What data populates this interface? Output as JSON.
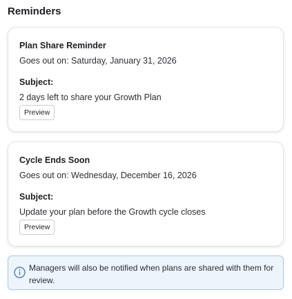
{
  "page": {
    "title": "Reminders"
  },
  "reminders": [
    {
      "title": "Plan Share Reminder",
      "goes_out": "Goes out on: Saturday, January 31, 2026",
      "subject_label": "Subject:",
      "subject": "2 days left to share your Growth Plan",
      "preview_label": "Preview"
    },
    {
      "title": "Cycle Ends Soon",
      "goes_out": "Goes out on: Wednesday, December 16, 2026",
      "subject_label": "Subject:",
      "subject": "Update your plan before the Growth cycle closes",
      "preview_label": "Preview"
    }
  ],
  "info": {
    "icon": "info-icon",
    "text": "Managers will also be notified when plans are shared with them for review."
  },
  "colors": {
    "info_background": "#edf4fb",
    "info_border": "#a8c7e8",
    "info_icon": "#2f6fb0",
    "card_border": "#e3e5e8"
  }
}
